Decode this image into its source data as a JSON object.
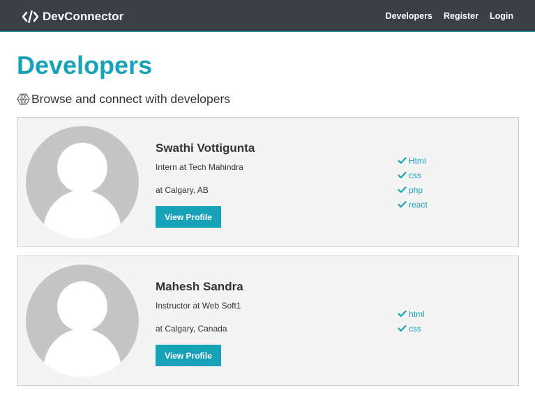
{
  "navbar": {
    "brand_label": "DevConnector",
    "brand_icon": "code-icon",
    "links": [
      {
        "label": "Developers"
      },
      {
        "label": "Register"
      },
      {
        "label": "Login"
      }
    ]
  },
  "page": {
    "title": "Developers",
    "lead_text": "Browse and connect with developers",
    "lead_icon": "connect-develop-icon"
  },
  "profiles": [
    {
      "name": "Swathi Vottigunta",
      "status": "Intern at Tech Mahindra",
      "location": "at Calgary, AB",
      "button_label": "View Profile",
      "skills": [
        "Html",
        "css",
        "php",
        "react"
      ]
    },
    {
      "name": "Mahesh Sandra",
      "status": "Instructor at Web Soft1",
      "location": "at Calgary, Canada",
      "button_label": "View Profile",
      "skills": [
        "html",
        "css"
      ]
    }
  ],
  "colors": {
    "accent": "#17a2b8",
    "navbar": "#343a40",
    "card_bg": "#f4f4f4",
    "avatar": "#c5c5c5"
  }
}
